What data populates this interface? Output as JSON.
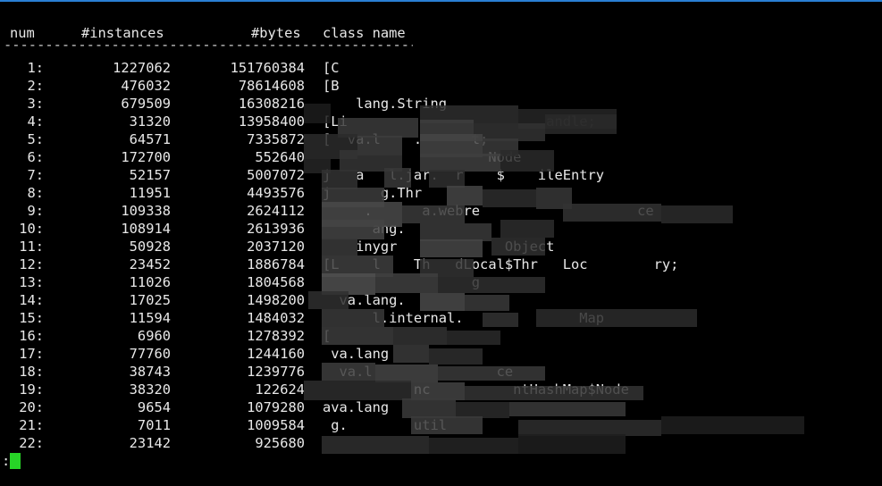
{
  "header": {
    "num": "num",
    "instances": "#instances",
    "bytes": "#bytes",
    "class_name": "class name"
  },
  "separator": "-----------------------------------------------------------",
  "rows": [
    {
      "num": "1:",
      "instances": "1227062",
      "bytes": "151760384",
      "class_name": "[C"
    },
    {
      "num": "2:",
      "instances": "476032",
      "bytes": "78614608",
      "class_name": "[B"
    },
    {
      "num": "3:",
      "instances": "679509",
      "bytes": "16308216",
      "class_name": "    lang.String"
    },
    {
      "num": "4:",
      "instances": "31320",
      "bytes": "13958400",
      "class_name": "[Li                        andle;"
    },
    {
      "num": "5:",
      "instances": "64571",
      "bytes": "7335872",
      "class_name": "[  va.l    .      t;"
    },
    {
      "num": "6:",
      "instances": "172700",
      "bytes": "552640",
      "class_name": "                    Node"
    },
    {
      "num": "7:",
      "instances": "52157",
      "bytes": "5007072",
      "class_name": "j   a   l.jar.  r    $    ileEntry"
    },
    {
      "num": "8:",
      "instances": "11951",
      "bytes": "4493576",
      "class_name": "j      g.Thr"
    },
    {
      "num": "9:",
      "instances": "109338",
      "bytes": "2624112",
      "class_name": "     .      a.webre                   ce"
    },
    {
      "num": "10:",
      "instances": "108914",
      "bytes": "2613936",
      "class_name": "      ang."
    },
    {
      "num": "11:",
      "instances": "50928",
      "bytes": "2037120",
      "class_name": "    inygr             Object"
    },
    {
      "num": "12:",
      "instances": "23452",
      "bytes": "1886784",
      "class_name": "[L    l    Th   dLocal$Thr   Loc        ry;"
    },
    {
      "num": "13:",
      "instances": "11026",
      "bytes": "1804568",
      "class_name": "                  g"
    },
    {
      "num": "14:",
      "instances": "17025",
      "bytes": "1498200",
      "class_name": "  va.lang."
    },
    {
      "num": "15:",
      "instances": "11594",
      "bytes": "1484032",
      "class_name": "      l.internal.              Map"
    },
    {
      "num": "16:",
      "instances": "6960",
      "bytes": "1278392",
      "class_name": "["
    },
    {
      "num": "17:",
      "instances": "77760",
      "bytes": "1244160",
      "class_name": " va.lang"
    },
    {
      "num": "18:",
      "instances": "38743",
      "bytes": "1239776",
      "class_name": "  va.l               ce"
    },
    {
      "num": "19:",
      "instances": "38320",
      "bytes": "122624",
      "class_name": "           nc          ntHashMap$Node"
    },
    {
      "num": "20:",
      "instances": "9654",
      "bytes": "1079280",
      "class_name": "ava.lang"
    },
    {
      "num": "21:",
      "instances": "7011",
      "bytes": "1009584",
      "class_name": " g.        util"
    },
    {
      "num": "22:",
      "instances": "23142",
      "bytes": "925680",
      "class_name": ""
    }
  ],
  "prompt": ":",
  "colors": {
    "background": "#000000",
    "text": "#e8e8e8",
    "cursor": "#27d427",
    "top_accent": "#2a7fd4",
    "redaction": "#3a3a3a"
  }
}
